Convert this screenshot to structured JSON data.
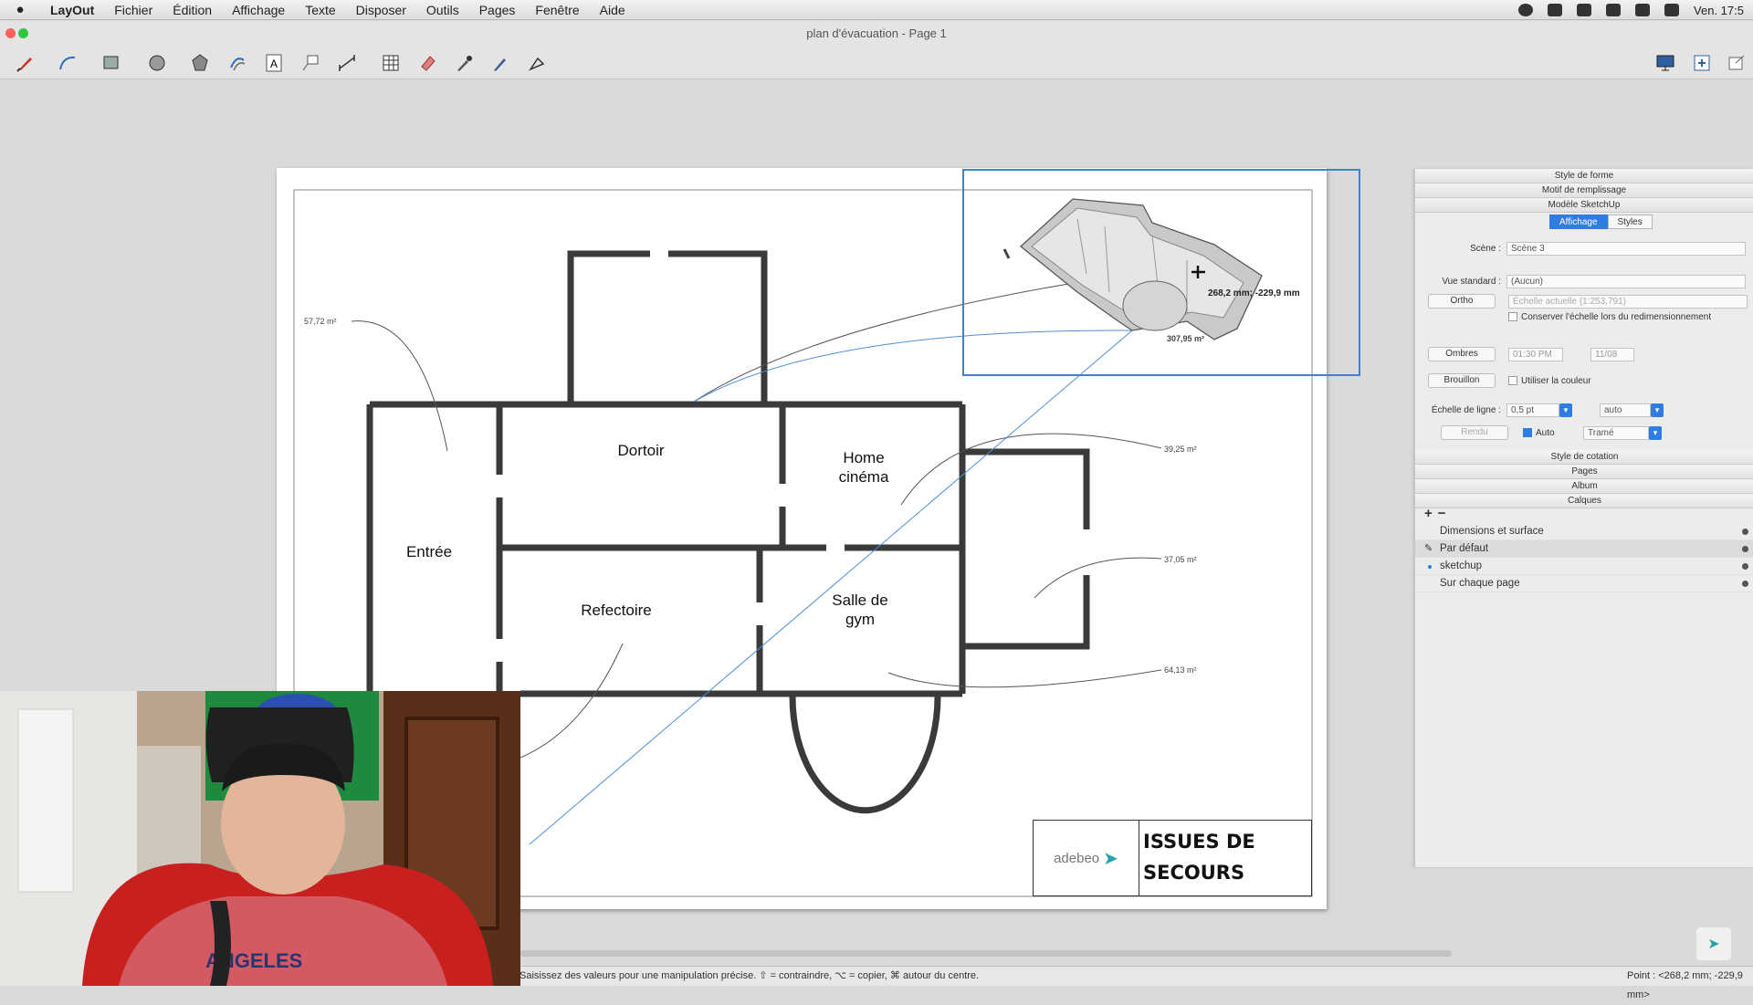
{
  "menubar": {
    "apple": "",
    "items": [
      "LayOut",
      "Fichier",
      "Édition",
      "Affichage",
      "Texte",
      "Disposer",
      "Outils",
      "Pages",
      "Fenêtre",
      "Aide"
    ],
    "clock": "Ven. 17:5"
  },
  "window": {
    "title": "plan d'évacuation - Page 1"
  },
  "toolbar": {
    "tools": [
      "pen-icon",
      "arc-icon",
      "rectangle-icon",
      "circle-icon",
      "polygon-icon",
      "offset-icon",
      "text-icon",
      "label-icon",
      "dimension-icon",
      "table-icon",
      "eraser-icon",
      "eyedropper-icon",
      "style-brush-icon",
      "split-icon"
    ],
    "right_tools": [
      "presentation-icon",
      "add-page-icon",
      "share-icon"
    ]
  },
  "plan": {
    "rooms": [
      {
        "label": "Dortoir"
      },
      {
        "label": "Home cinéma"
      },
      {
        "label": "Entrée"
      },
      {
        "label": "Refectoire"
      },
      {
        "label": "Salle de gym"
      }
    ],
    "areas": [
      "57,72 m²",
      "39,25 m²",
      "37,05 m²",
      "64,13 m²",
      "307,95 m²"
    ],
    "viewport_dims": "268,2 mm; -229,9 mm"
  },
  "titleblock": {
    "logo_text": "adebeo",
    "title_line1": "ISSUES DE",
    "title_line2": "SECOURS"
  },
  "panel": {
    "headers": [
      "Style de forme",
      "Motif de remplissage",
      "Modèle SketchUp"
    ],
    "tabs": [
      "Affichage",
      "Styles"
    ],
    "scene_label": "Scène :",
    "scene_value": "Scène 3",
    "view_label": "Vue standard :",
    "view_value": "(Aucun)",
    "ortho_button": "Ortho",
    "scale_value": "Échelle actuelle (1:253,791)",
    "preserve_scale": "Conserver l'échelle lors du redimensionnement",
    "shadows_button": "Ombres",
    "shadow_time": "01:30 PM",
    "shadow_date": "11/08",
    "draft_button": "Brouillon",
    "use_color": "Utiliser la couleur",
    "line_scale_label": "Échelle de ligne :",
    "line_scale_value": "0,5 pt",
    "line_scale_auto_value": "auto",
    "render_button": "Rendu",
    "auto_label": "Auto",
    "render_mode": "Tramé",
    "section_headers": [
      "Style de cotation",
      "Pages",
      "Album",
      "Calques"
    ],
    "layer_add": "+",
    "layer_remove": "−",
    "layers": [
      {
        "name": "Dimensions et surface"
      },
      {
        "name": "Par défaut"
      },
      {
        "name": "sketchup"
      },
      {
        "name": "Sur chaque page"
      }
    ]
  },
  "status": {
    "hint": "Saisissez des valeurs pour une manipulation précise. ⇧ = contraindre, ⌥ = copier, ⌘ autour du centre.",
    "point": "Point : <268,2 mm; -229,9 mm>"
  },
  "colors": {
    "selection": "#3b82d6",
    "accent": "#2f7de1",
    "wall": "#3a3a3a"
  }
}
